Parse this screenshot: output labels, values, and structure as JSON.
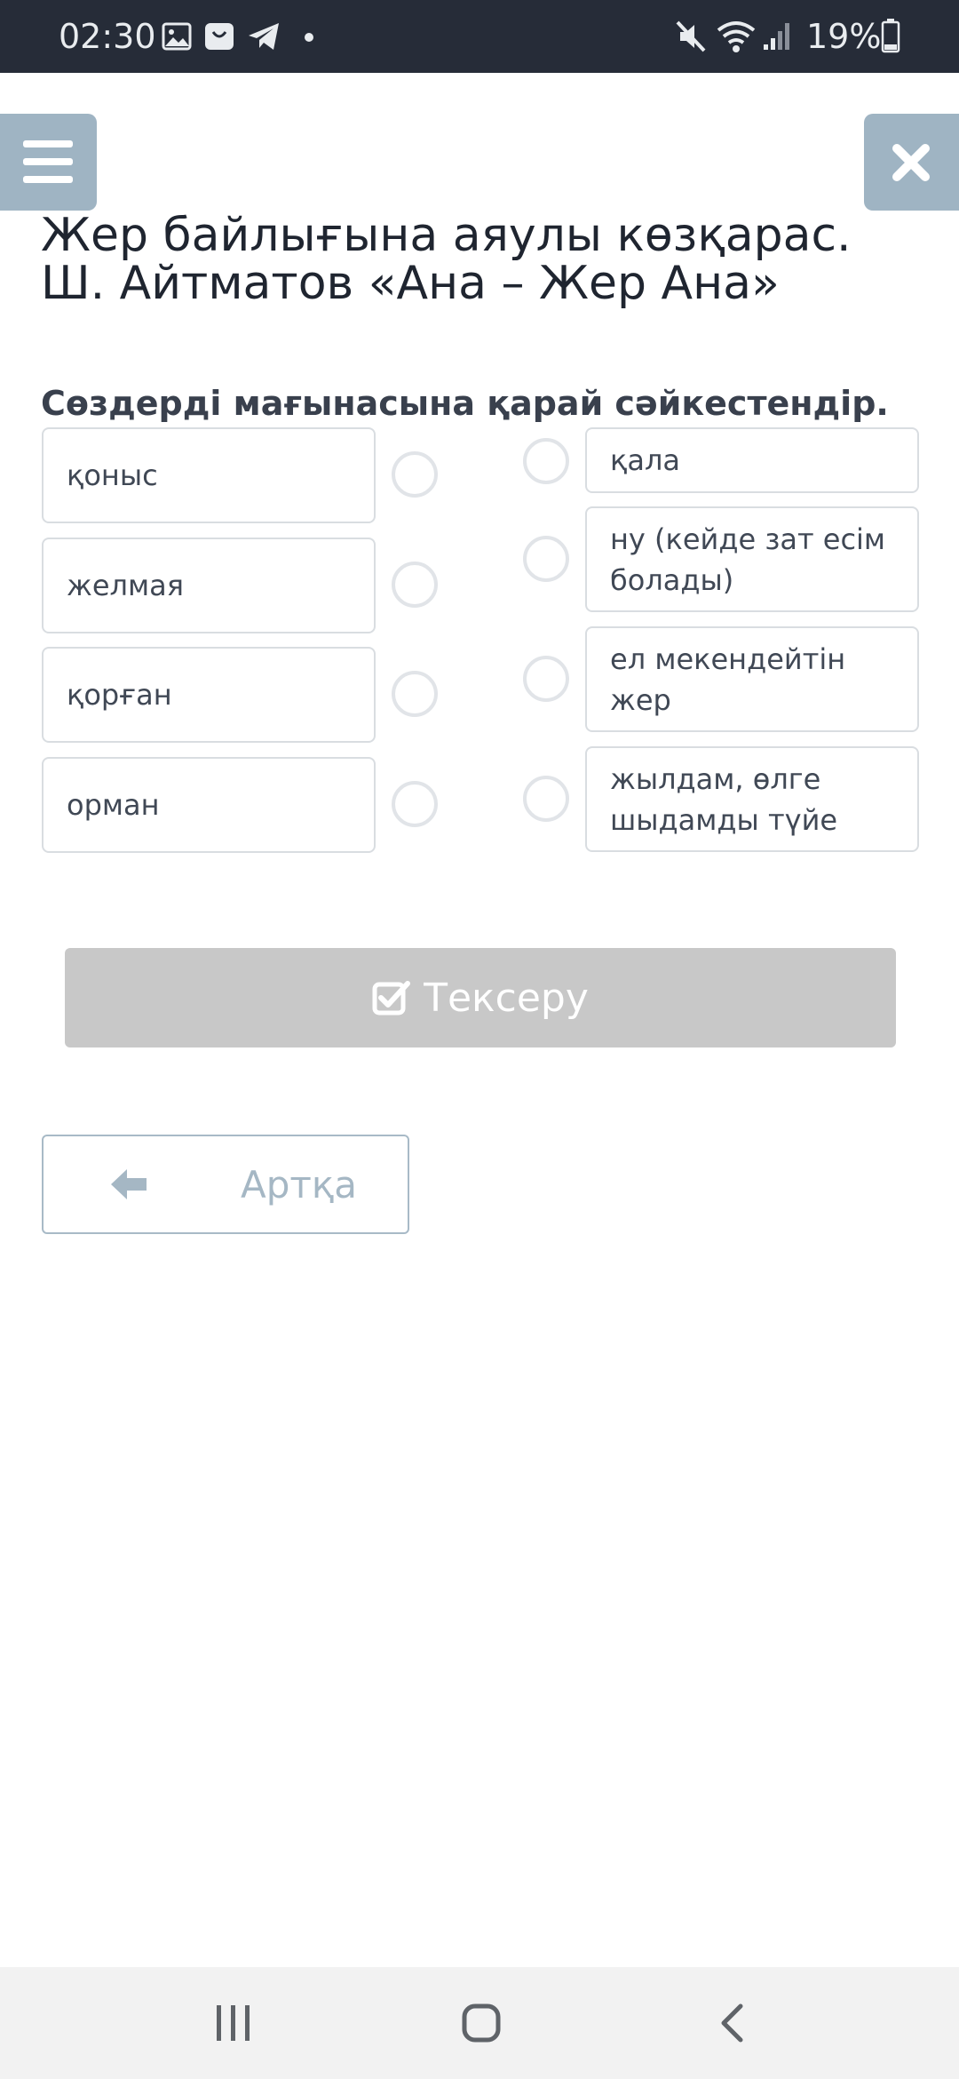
{
  "status_bar": {
    "time": "02:30",
    "battery": "19%",
    "icons": [
      "image-icon",
      "bag-icon",
      "telegram-icon",
      "dot-icon",
      "mute-icon",
      "wifi-icon",
      "signal-icon",
      "battery-icon"
    ]
  },
  "header": {
    "menu_icon": "hamburger-menu-icon",
    "close_icon": "close-icon"
  },
  "title": "Жер байлығына аяулы көзқарас. Ш. Айтматов «Ана – Жер Ана»",
  "question": "Сөздерді мағынасына қарай сәйкестендір.",
  "left_items": [
    {
      "label": "қоныс"
    },
    {
      "label": "желмая"
    },
    {
      "label": "қорған"
    },
    {
      "label": "орман"
    }
  ],
  "right_items": [
    {
      "label": "қала"
    },
    {
      "label": "ну (кейде зат есім болады)"
    },
    {
      "label": "ел мекендейтін жер"
    },
    {
      "label": "жылдам, өлге шыдамды түйе"
    }
  ],
  "buttons": {
    "check_label": "Тексеру",
    "back_label": "Артқа"
  },
  "nav_bar": {
    "icons": [
      "recent-apps-icon",
      "home-icon",
      "back-icon"
    ]
  },
  "colors": {
    "status_bar_bg": "#262c38",
    "accent_button": "#9fb4c3",
    "disabled_button": "#c8c8c8",
    "card_border": "#d9dde1"
  }
}
